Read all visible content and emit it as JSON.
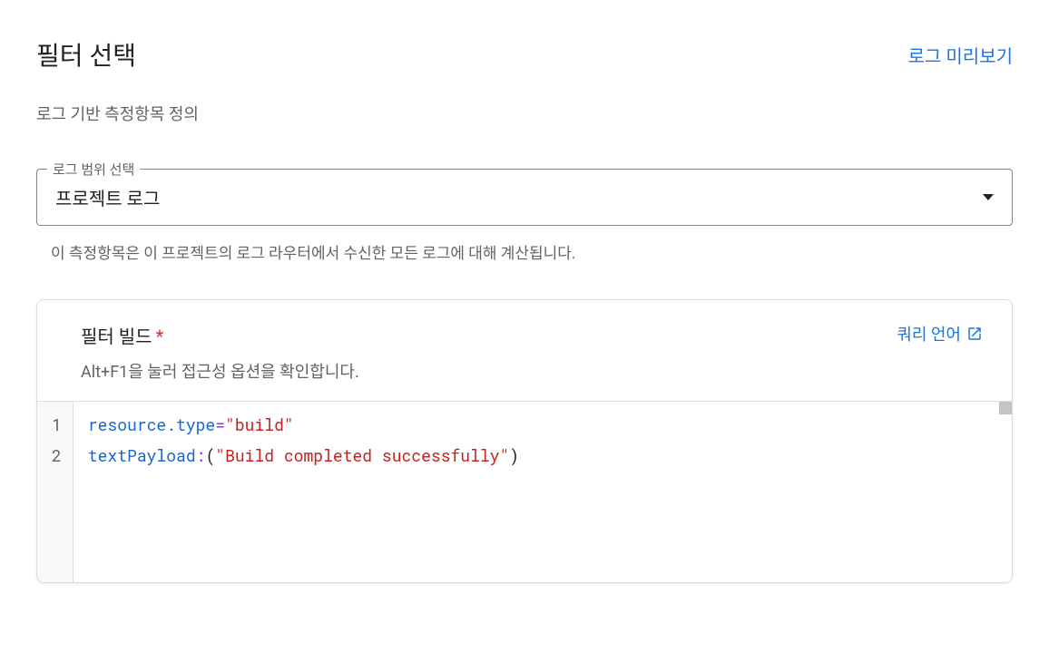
{
  "header": {
    "title": "필터 선택",
    "preview_link": "로그 미리보기"
  },
  "subtitle": "로그 기반 측정항목 정의",
  "scope_select": {
    "label": "로그 범위 선택",
    "value": "프로젝트 로그",
    "helper": "이 측정항목은 이 프로젝트의 로그 라우터에서 수신한 모든 로그에 대해 계산됩니다."
  },
  "filter_build": {
    "title": "필터 빌드",
    "hint": "Alt+F1을 눌러 접근성 옵션을 확인합니다.",
    "query_lang_link": "쿼리 언어",
    "code": {
      "lines": [
        "1",
        "2"
      ],
      "line1": {
        "property": "resource.type",
        "operator": "=",
        "string": "\"build\""
      },
      "line2": {
        "property": "textPayload",
        "operator": ":",
        "paren_open": "(",
        "string": "\"Build completed successfully\"",
        "paren_close": ")"
      }
    }
  }
}
